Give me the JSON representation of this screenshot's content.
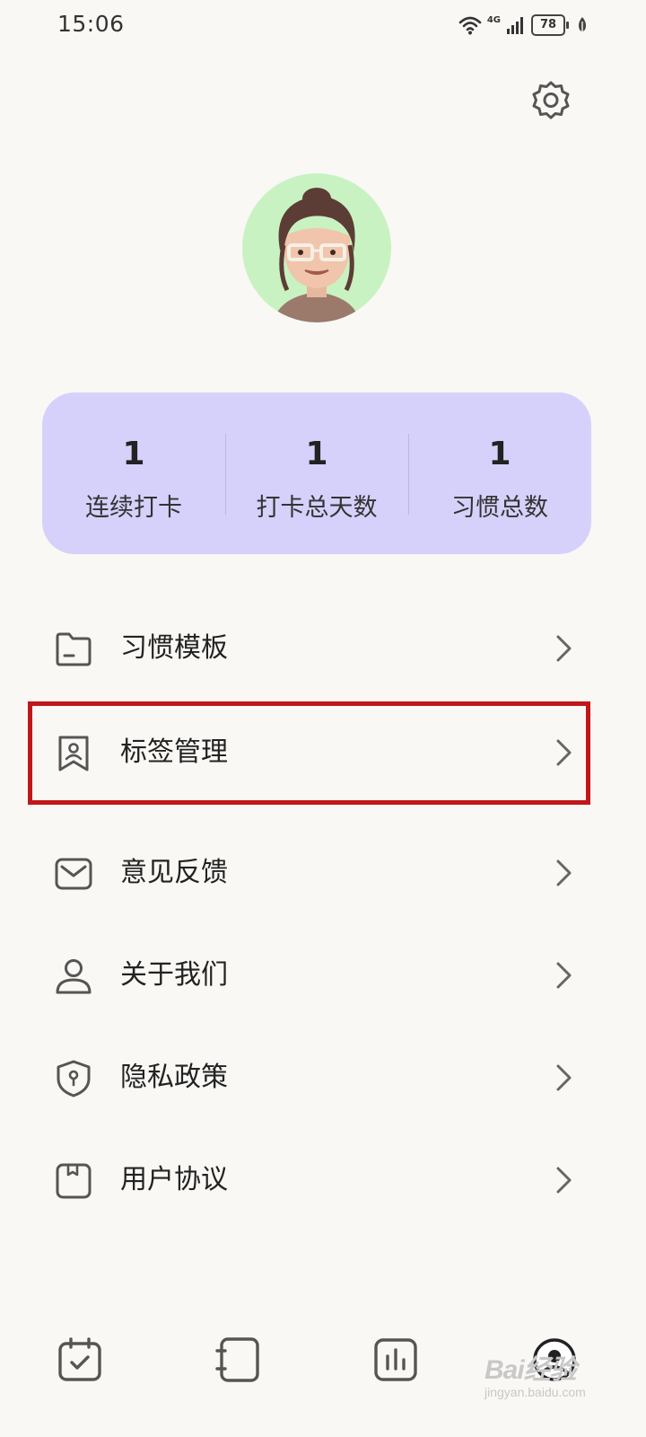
{
  "status_bar": {
    "time": "15:06",
    "network": "4G",
    "battery": "78"
  },
  "stats": [
    {
      "value": "1",
      "label": "连续打卡"
    },
    {
      "value": "1",
      "label": "打卡总天数"
    },
    {
      "value": "1",
      "label": "习惯总数"
    }
  ],
  "menu": [
    {
      "label": "习惯模板",
      "icon": "folder-icon"
    },
    {
      "label": "标签管理",
      "icon": "bookmark-icon"
    },
    {
      "label": "意见反馈",
      "icon": "mail-icon"
    },
    {
      "label": "关于我们",
      "icon": "person-icon"
    },
    {
      "label": "隐私政策",
      "icon": "shield-icon"
    },
    {
      "label": "用户协议",
      "icon": "document-icon"
    }
  ],
  "bottom_nav": [
    {
      "icon": "calendar-check-icon"
    },
    {
      "icon": "notebook-icon"
    },
    {
      "icon": "bar-chart-icon"
    },
    {
      "icon": "profile-icon"
    }
  ],
  "watermark": {
    "main": "Bai经验",
    "sub": "jingyan.baidu.com"
  },
  "colors": {
    "background": "#f9f8f4",
    "stats_card": "#d6d1fb",
    "avatar_bg": "#c8f2c2",
    "highlight_border": "#c1161a",
    "icon": "#555555"
  }
}
